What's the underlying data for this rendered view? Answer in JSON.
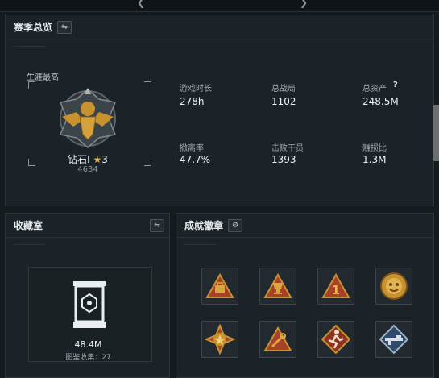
{
  "season_overview": {
    "title": "赛季总览",
    "rank_caption": "生涯最高",
    "rank_name": "钻石I",
    "rank_star": "★",
    "rank_level": "3",
    "rank_score": "4634",
    "stats": [
      {
        "label": "游戏时长",
        "value": "278h"
      },
      {
        "label": "总战局",
        "value": "1102"
      },
      {
        "label": "总资产",
        "value": "248.5M",
        "help": "?"
      },
      {
        "label": "撤离率",
        "value": "47.7%"
      },
      {
        "label": "击败干员",
        "value": "1393"
      },
      {
        "label": "赚损比",
        "value": "1.3M"
      }
    ]
  },
  "collection": {
    "title": "收藏室",
    "value": "48.4M",
    "catalog_label": "图鉴收集：",
    "catalog_count": "27"
  },
  "achievements": {
    "title": "成就徽章",
    "badges": [
      "bag-triangle-badge",
      "trophy-triangle-badge",
      "number-one-triangle-badge",
      "gold-tiger-emblem-badge",
      "star-cross-emblem-badge",
      "tool-triangle-badge",
      "runner-diamond-badge",
      "rifle-diamond-badge"
    ]
  },
  "colors": {
    "panel": "#1c2328",
    "gold": "#c8922e",
    "accent_red": "#a8402a"
  }
}
